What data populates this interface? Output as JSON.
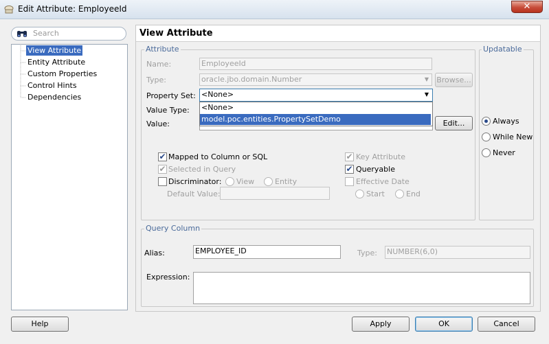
{
  "window": {
    "title": "Edit Attribute: EmployeeId",
    "close_label": "✕"
  },
  "search": {
    "placeholder": "Search"
  },
  "nav": {
    "items": [
      {
        "label": "View Attribute"
      },
      {
        "label": "Entity Attribute"
      },
      {
        "label": "Custom Properties"
      },
      {
        "label": "Control Hints"
      },
      {
        "label": "Dependencies"
      }
    ]
  },
  "panel": {
    "title": "View Attribute",
    "attribute_group": "Attribute",
    "name_label": "Name:",
    "name_value": "EmployeeId",
    "type_label": "Type:",
    "type_value": "oracle.jbo.domain.Number",
    "browse_label": "Browse...",
    "property_set_label": "Property Set:",
    "property_set_value": "<None>",
    "property_set_options": [
      "<None>",
      "model.poc.entities.PropertySetDemo"
    ],
    "value_type_label": "Value Type:",
    "value_label": "Value:",
    "edit_label": "Edit...",
    "mapped_label": "Mapped to Column or SQL",
    "selected_in_query_label": "Selected in Query",
    "discriminator_label": "Discriminator:",
    "view_label": "View",
    "entity_label": "Entity",
    "default_value_label": "Default Value:",
    "key_attribute_label": "Key Attribute",
    "queryable_label": "Queryable",
    "effective_date_label": "Effective Date",
    "start_label": "Start",
    "end_label": "End",
    "updatable_group": "Updatable",
    "always_label": "Always",
    "while_new_label": "While New",
    "never_label": "Never",
    "query_column_group": "Query Column",
    "alias_label": "Alias:",
    "alias_value": "EMPLOYEE_ID",
    "qc_type_label": "Type:",
    "qc_type_value": "NUMBER(6,0)",
    "expression_label": "Expression:"
  },
  "footer": {
    "help": "Help",
    "apply": "Apply",
    "ok": "OK",
    "cancel": "Cancel"
  }
}
